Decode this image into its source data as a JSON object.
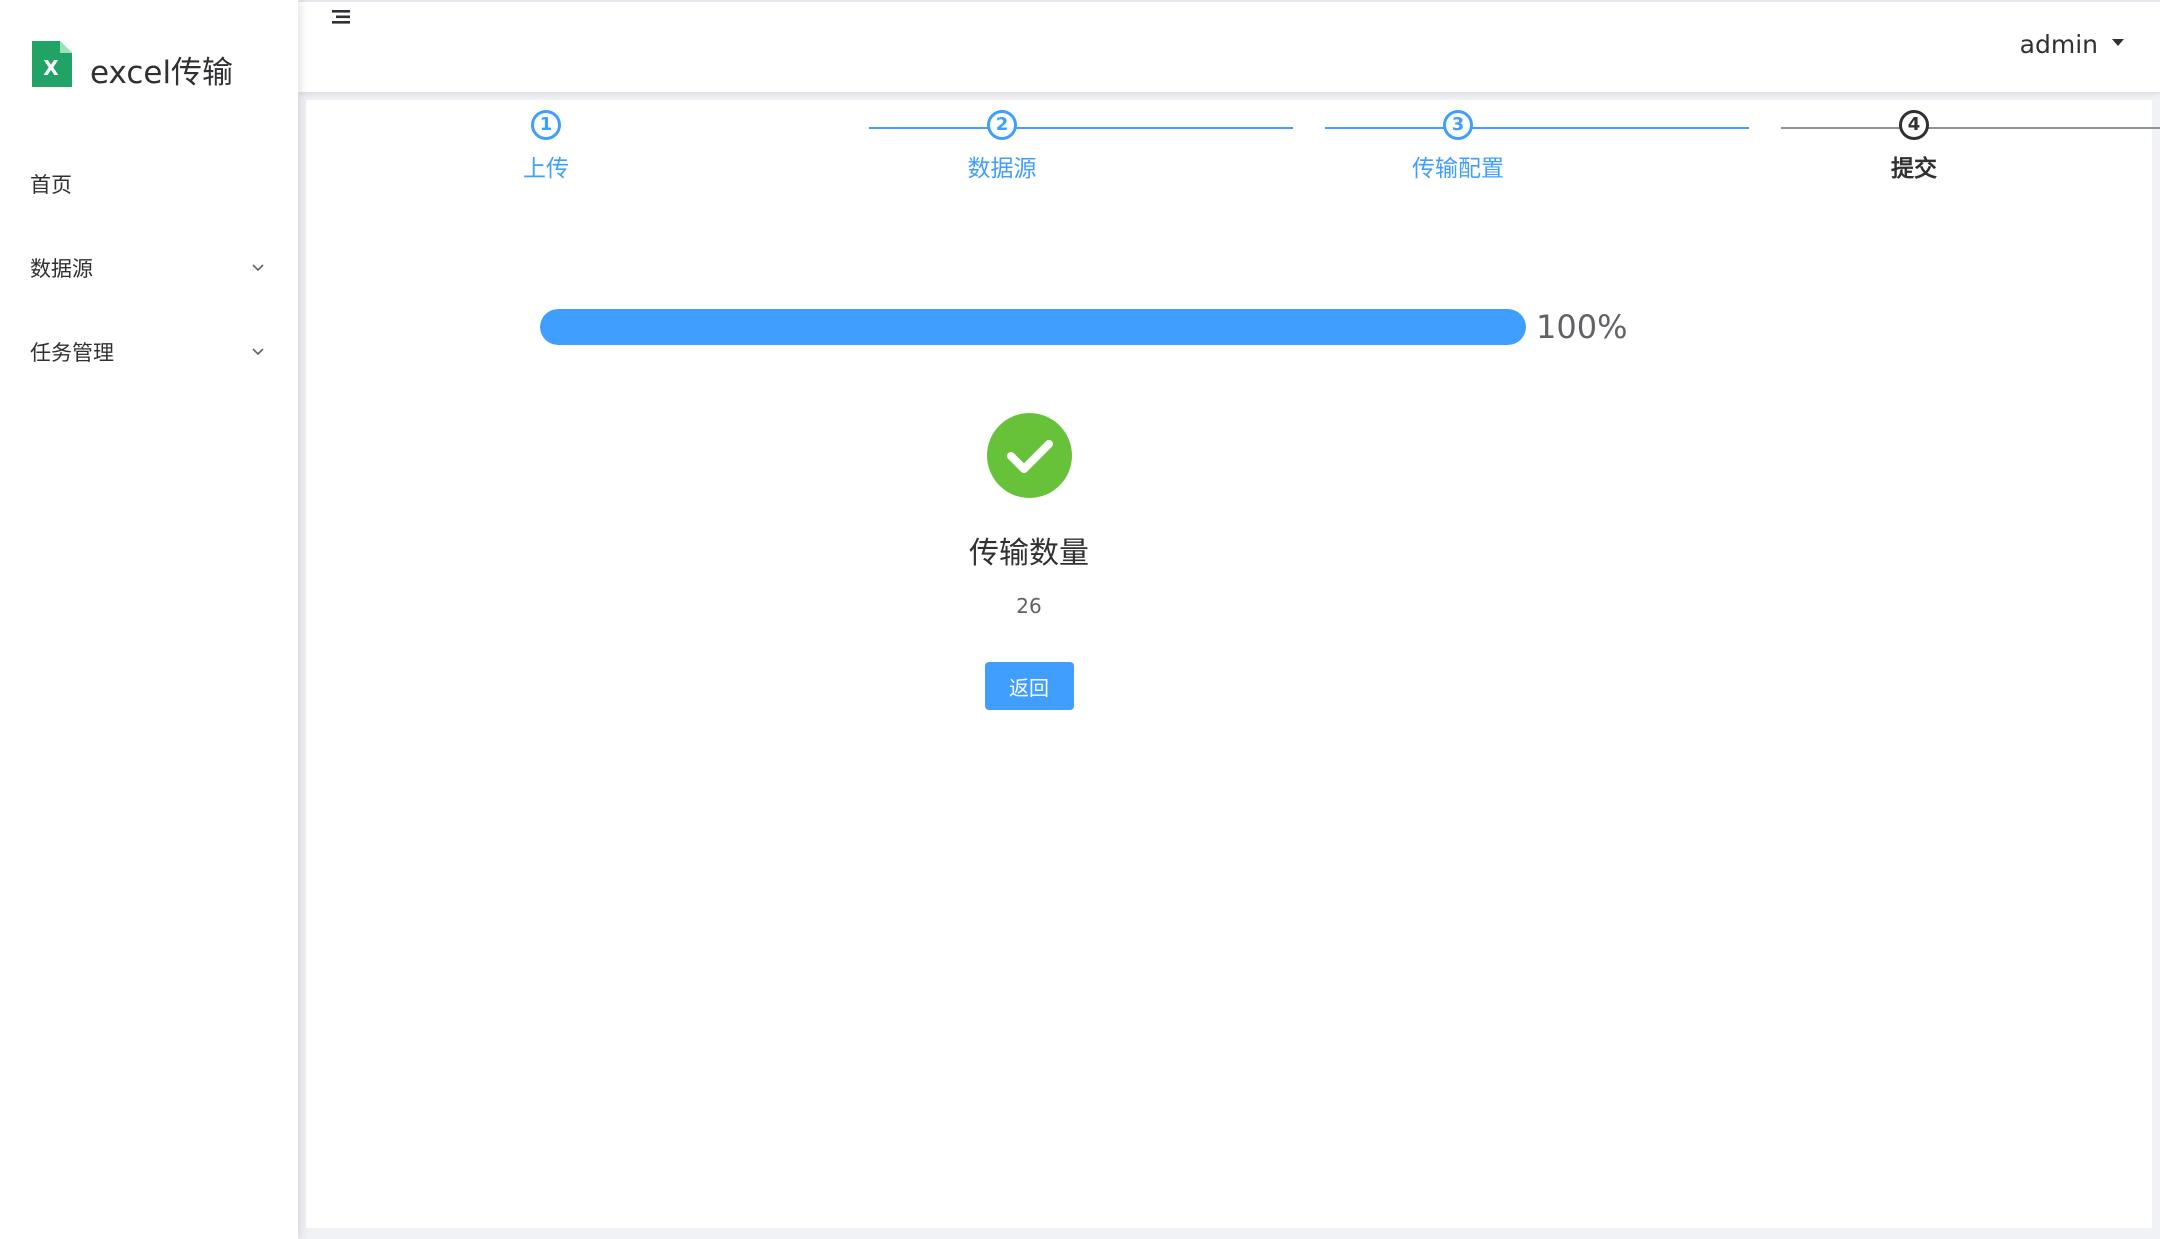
{
  "app": {
    "title": "excel传输"
  },
  "sidebar": {
    "items": [
      {
        "label": "首页",
        "has_children": false
      },
      {
        "label": "数据源",
        "has_children": true
      },
      {
        "label": "任务管理",
        "has_children": true
      }
    ]
  },
  "header": {
    "user": "admin"
  },
  "steps": [
    {
      "number": "1",
      "title": "上传",
      "status": "finished"
    },
    {
      "number": "2",
      "title": "数据源",
      "status": "finished"
    },
    {
      "number": "3",
      "title": "传输配置",
      "status": "finished"
    },
    {
      "number": "4",
      "title": "提交",
      "status": "active"
    }
  ],
  "progress": {
    "percent": 100,
    "label": "100%",
    "color": "#409eff"
  },
  "result": {
    "title": "传输数量",
    "count": "26",
    "button_label": "返回",
    "success_color": "#67c23a"
  },
  "colors": {
    "primary": "#409eff",
    "success": "#67c23a",
    "text": "#303133",
    "logo_green": "#21a366"
  }
}
